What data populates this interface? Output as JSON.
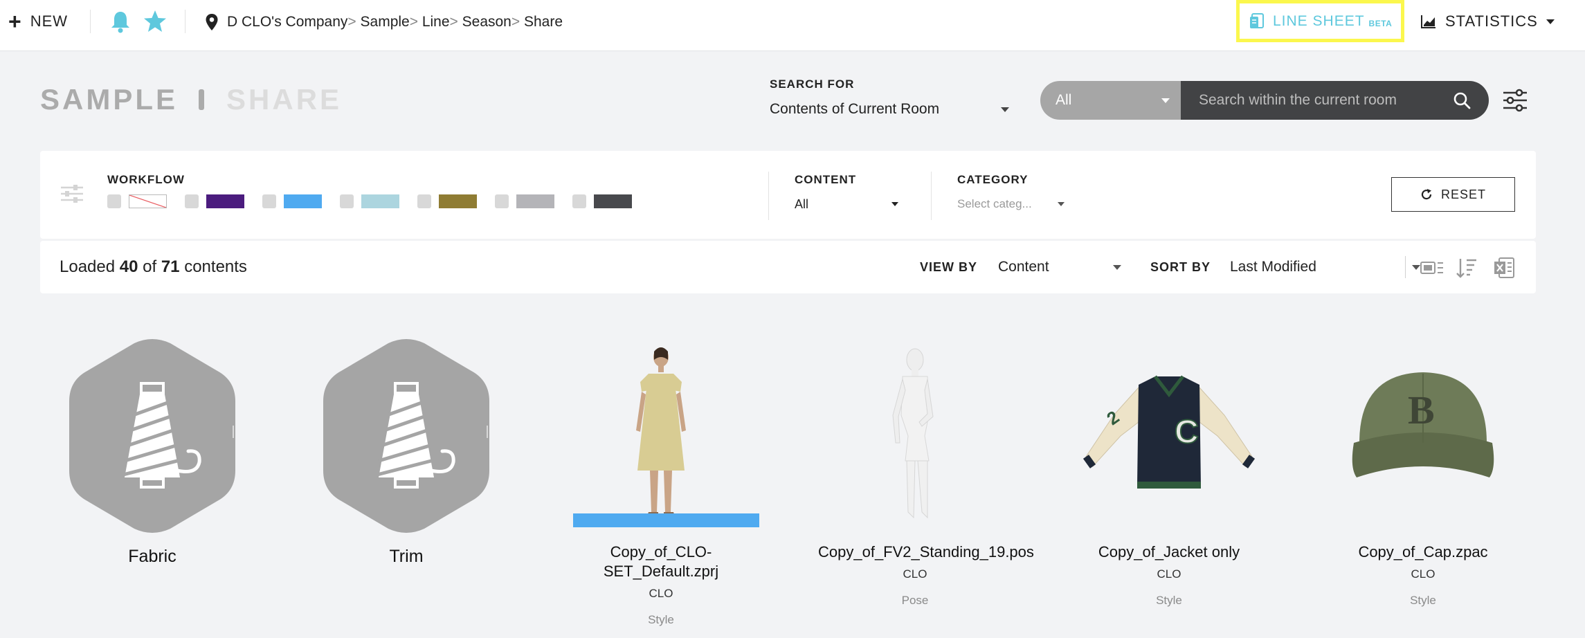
{
  "topbar": {
    "new_label": "NEW",
    "breadcrumb": [
      "D CLO's Company",
      "Sample",
      "Line",
      "Season",
      "Share"
    ],
    "breadcrumb_separator": ">",
    "line_sheet_label": "LINE SHEET",
    "line_sheet_badge": "BETA",
    "statistics_label": "STATISTICS"
  },
  "title": {
    "primary": "SAMPLE",
    "secondary": "SHARE"
  },
  "search": {
    "for_label": "SEARCH FOR",
    "for_value": "Contents of Current Room",
    "scope_value": "All",
    "placeholder": "Search within the current room"
  },
  "filters": {
    "workflow_label": "WORKFLOW",
    "workflow_swatches": [
      "none",
      "#4b1c7e",
      "#4faaf0",
      "#acd5df",
      "#8f7c33",
      "#b4b4b8",
      "#48494d"
    ],
    "content_label": "CONTENT",
    "content_value": "All",
    "category_label": "CATEGORY",
    "category_placeholder": "Select categ...",
    "reset_label": "RESET"
  },
  "results": {
    "loaded_prefix": "Loaded",
    "loaded_count": "40",
    "loaded_of": "of",
    "total_count": "71",
    "loaded_suffix": "contents",
    "view_by_label": "VIEW BY",
    "view_by_value": "Content",
    "sort_by_label": "SORT BY",
    "sort_by_value": "Last Modified"
  },
  "items": [
    {
      "name": "Fabric"
    },
    {
      "name": "Trim"
    },
    {
      "name": "Copy_of_CLO-SET_Default.zprj",
      "owner": "CLO",
      "type": "Style"
    },
    {
      "name": "Copy_of_FV2_Standing_19.pos",
      "owner": "CLO",
      "type": "Pose"
    },
    {
      "name": "Copy_of_Jacket only",
      "owner": "CLO",
      "type": "Style"
    },
    {
      "name": "Copy_of_Cap.zpac",
      "owner": "CLO",
      "type": "Style"
    }
  ],
  "colors": {
    "accent": "#5ec8dd",
    "highlight": "#fbf74d",
    "search_dark": "#424345",
    "bell": "#5ec8dd"
  }
}
